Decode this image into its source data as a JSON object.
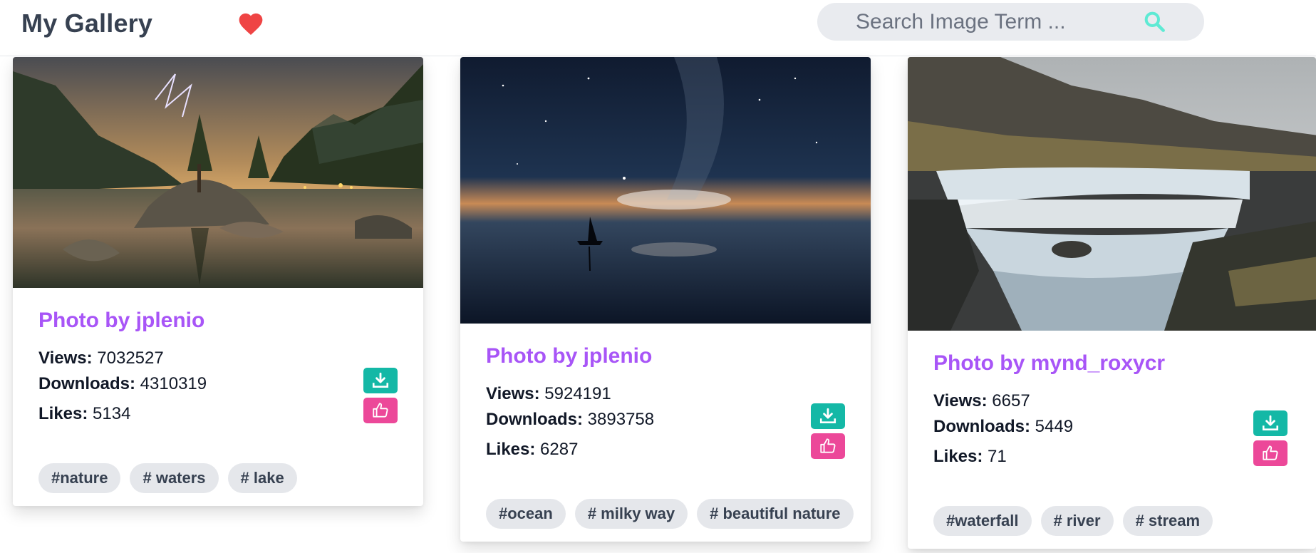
{
  "header": {
    "title": "My Gallery",
    "search_placeholder": "Search Image Term ..."
  },
  "icons": {
    "favorite": "heart-icon",
    "search": "search-icon",
    "download": "download-icon",
    "like": "thumbs-up-icon"
  },
  "colors": {
    "author": "#a855f7",
    "download_button": "#14b8a6",
    "like_button": "#ec4899",
    "heart": "#ef4444",
    "search_icon": "#5eead4"
  },
  "labels": {
    "views": "Views:",
    "downloads": "Downloads:",
    "likes": "Likes:"
  },
  "cards": [
    {
      "author": "Photo by jplenio",
      "views": "7032527",
      "downloads": "4310319",
      "likes": "5134",
      "tags": [
        "#nature",
        "# waters",
        "# lake"
      ],
      "image": "lake-lightning-scene"
    },
    {
      "author": "Photo by jplenio",
      "views": "5924191",
      "downloads": "3893758",
      "likes": "6287",
      "tags": [
        "#ocean",
        "# milky way",
        "# beautiful nature"
      ],
      "image": "milky-way-sailboat-scene"
    },
    {
      "author": "Photo by mynd_roxycr",
      "views": "6657",
      "downloads": "5449",
      "likes": "71",
      "tags": [
        "#waterfall",
        "# river",
        "# stream"
      ],
      "image": "waterfall-river-scene"
    }
  ]
}
